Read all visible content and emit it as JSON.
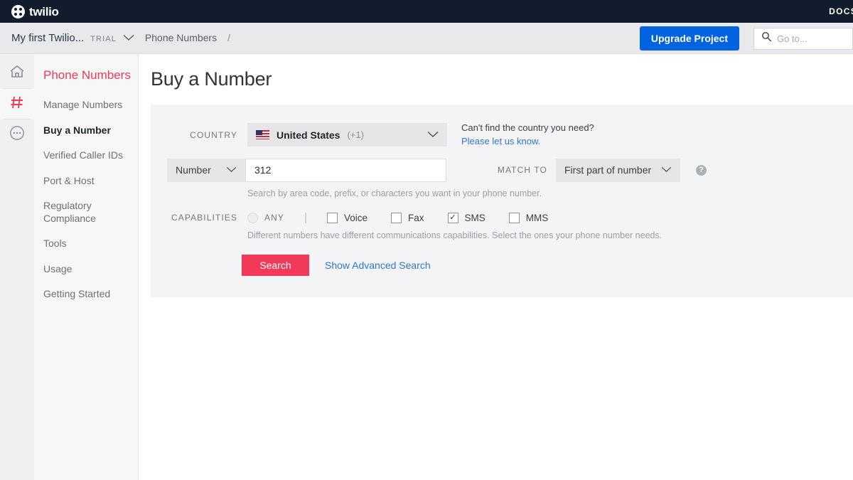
{
  "topbar": {
    "logo_text": "twilio",
    "logo_icon": "twilio-dots-logo-icon",
    "docs_label": "DOCS"
  },
  "breadcrumb": {
    "project_name": "My first Twilio...",
    "trial_badge": "TRIAL",
    "chevron_icon": "chevron-down-icon",
    "page_name": "Phone Numbers",
    "separator": "/",
    "upgrade_label": "Upgrade Project",
    "upgrade_color": "#0263E0",
    "search_icon": "search-icon",
    "search_placeholder": "Go to..."
  },
  "rail": {
    "items": [
      {
        "icon": "home-icon",
        "active": false
      },
      {
        "icon": "hash-icon",
        "active": true
      },
      {
        "icon": "ellipsis-circle-icon",
        "active": false
      }
    ]
  },
  "sidebar": {
    "title": "Phone Numbers",
    "title_color": "#F2395A",
    "items": [
      {
        "label": "Manage Numbers"
      },
      {
        "label": "Buy a Number"
      },
      {
        "label": "Verified Caller IDs"
      },
      {
        "label": "Port & Host"
      },
      {
        "label": "Regulatory Compliance"
      },
      {
        "label": "Tools"
      },
      {
        "label": "Usage"
      },
      {
        "label": "Getting Started"
      }
    ],
    "current_label": "Buy a Number"
  },
  "main": {
    "page_title": "Buy a Number",
    "country": {
      "label": "COUNTRY",
      "flag_icon": "us-flag-icon",
      "name": "United States",
      "dial_code": "(+1)",
      "chevron_icon": "chevron-down-icon",
      "aside_question": "Can't find the country you need?",
      "aside_link": "Please let us know.",
      "aside_link_color": "#2B7ACB"
    },
    "number": {
      "type_value": "Number",
      "type_chevron_icon": "chevron-down-icon",
      "input_value": "312",
      "input_placeholder": "",
      "match_label": "MATCH TO",
      "match_value": "First part of number",
      "match_chevron_icon": "chevron-down-icon",
      "help_icon": "question-mark-help-icon",
      "hint": "Search by area code, prefix, or characters you want in your phone number."
    },
    "capabilities": {
      "label": "CAPABILITIES",
      "any_label": "ANY",
      "any_icon": "radio-unchecked-icon",
      "options": [
        {
          "label": "Voice",
          "checked": false
        },
        {
          "label": "Fax",
          "checked": false
        },
        {
          "label": "SMS",
          "checked": true
        },
        {
          "label": "MMS",
          "checked": false
        }
      ],
      "check_glyph": "✓",
      "hint": "Different numbers have different communications capabilities. Select the ones your phone number needs."
    },
    "actions": {
      "search_label": "Search",
      "search_color": "#F2395A",
      "advanced_label": "Show Advanced Search",
      "advanced_color": "#2B7ACB"
    }
  }
}
